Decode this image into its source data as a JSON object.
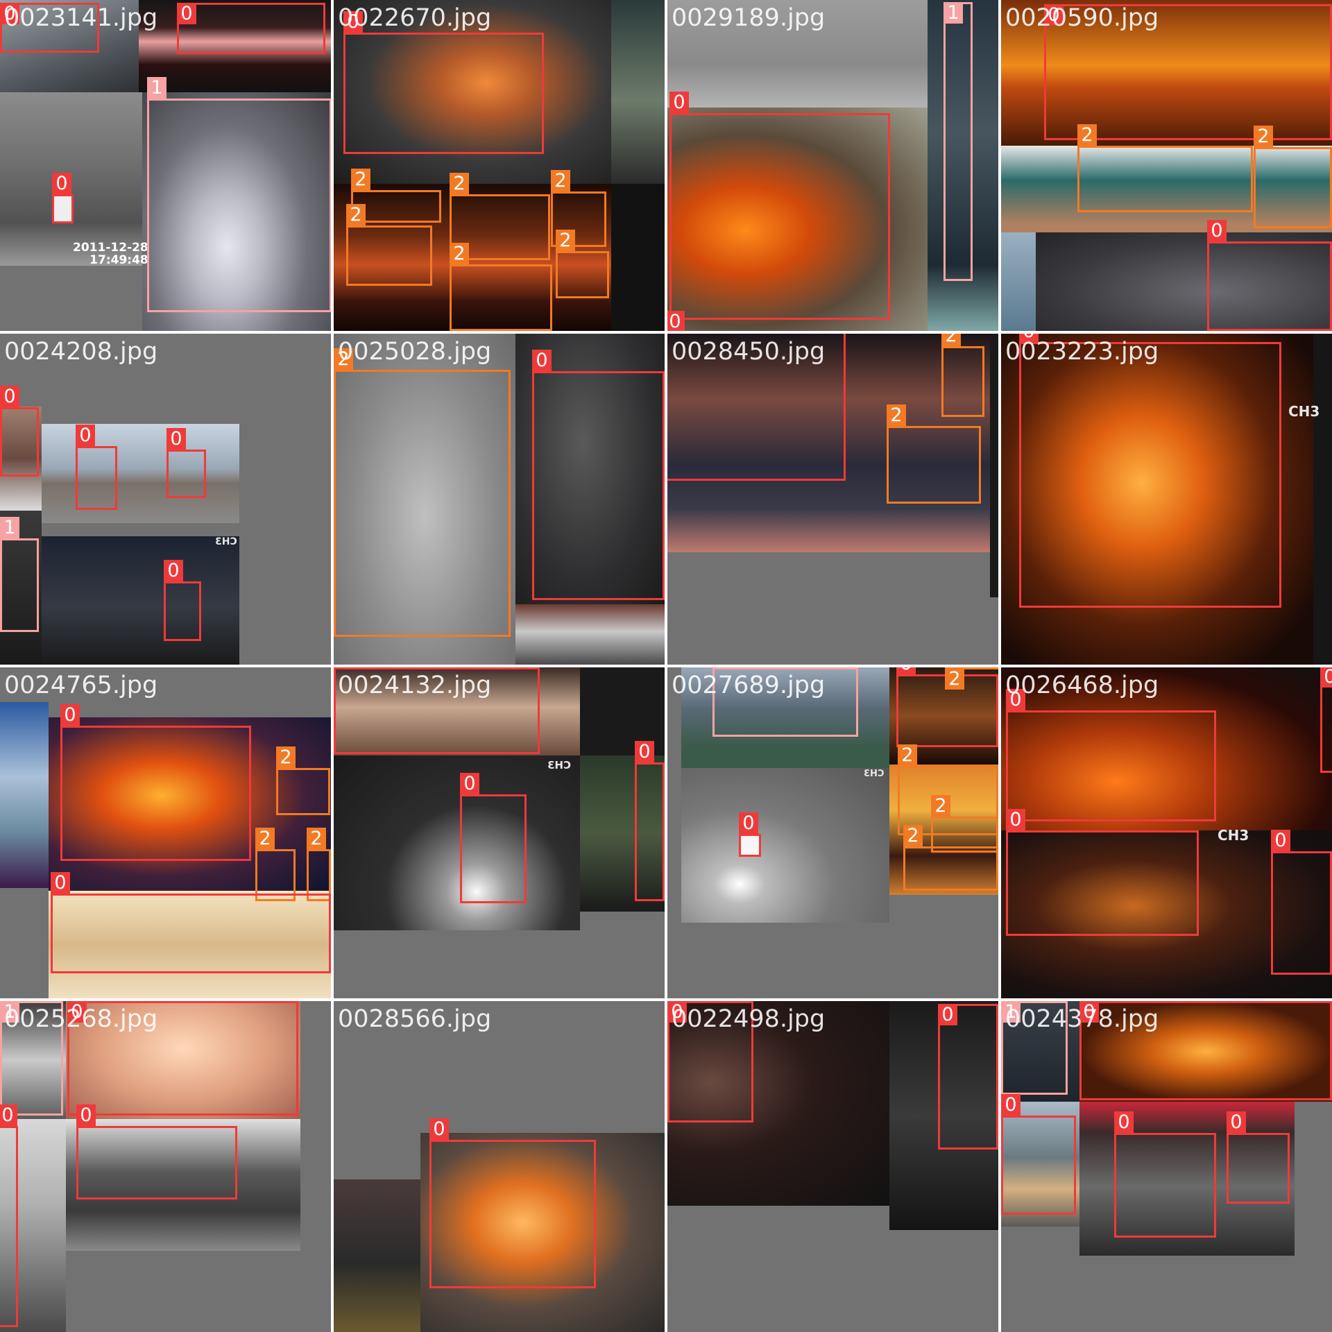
{
  "class_colors": {
    "0": "#ef3a3a",
    "1": "#f7a3a3",
    "2": "#f27a24"
  },
  "tiles": [
    {
      "name": "0023141.jpg",
      "boxes": [
        "0",
        "0",
        "0",
        "1"
      ],
      "stamp": "2011-12-28\n17:49:48"
    },
    {
      "name": "0022670.jpg",
      "boxes": [
        "0",
        "2",
        "2",
        "2",
        "2",
        "2",
        "2"
      ]
    },
    {
      "name": "0029189.jpg",
      "boxes": [
        "1",
        "0",
        "0"
      ]
    },
    {
      "name": "0020590.jpg",
      "boxes": [
        "0",
        "2",
        "2",
        "0"
      ]
    },
    {
      "name": "0024208.jpg",
      "boxes": [
        "0",
        "0",
        "0",
        "1",
        "0"
      ],
      "ch3": "CH3"
    },
    {
      "name": "0025028.jpg",
      "boxes": [
        "2",
        "0"
      ]
    },
    {
      "name": "0028450.jpg",
      "boxes": [
        "2",
        "2"
      ]
    },
    {
      "name": "0023223.jpg",
      "boxes": [
        "0"
      ],
      "ch3": "CH3"
    },
    {
      "name": "0024765.jpg",
      "boxes": [
        "0",
        "2",
        "2",
        "2",
        "0"
      ]
    },
    {
      "name": "0024132.jpg",
      "boxes": [
        "0",
        "0",
        "0"
      ],
      "ch3": "CH3"
    },
    {
      "name": "0027689.jpg",
      "boxes": [
        "1",
        "0",
        "2",
        "2",
        "2",
        "2",
        "0"
      ],
      "ch3": "CH3"
    },
    {
      "name": "0026468.jpg",
      "boxes": [
        "0",
        "0",
        "0",
        "0"
      ],
      "ch3": "CH3"
    },
    {
      "name": "0025268.jpg",
      "boxes": [
        "1",
        "0",
        "0",
        "0"
      ]
    },
    {
      "name": "0028566.jpg",
      "boxes": [
        "0"
      ]
    },
    {
      "name": "0022498.jpg",
      "boxes": [
        "0",
        "0"
      ]
    },
    {
      "name": "0024378.jpg",
      "boxes": [
        "1",
        "0",
        "0",
        "0",
        "0"
      ]
    }
  ]
}
